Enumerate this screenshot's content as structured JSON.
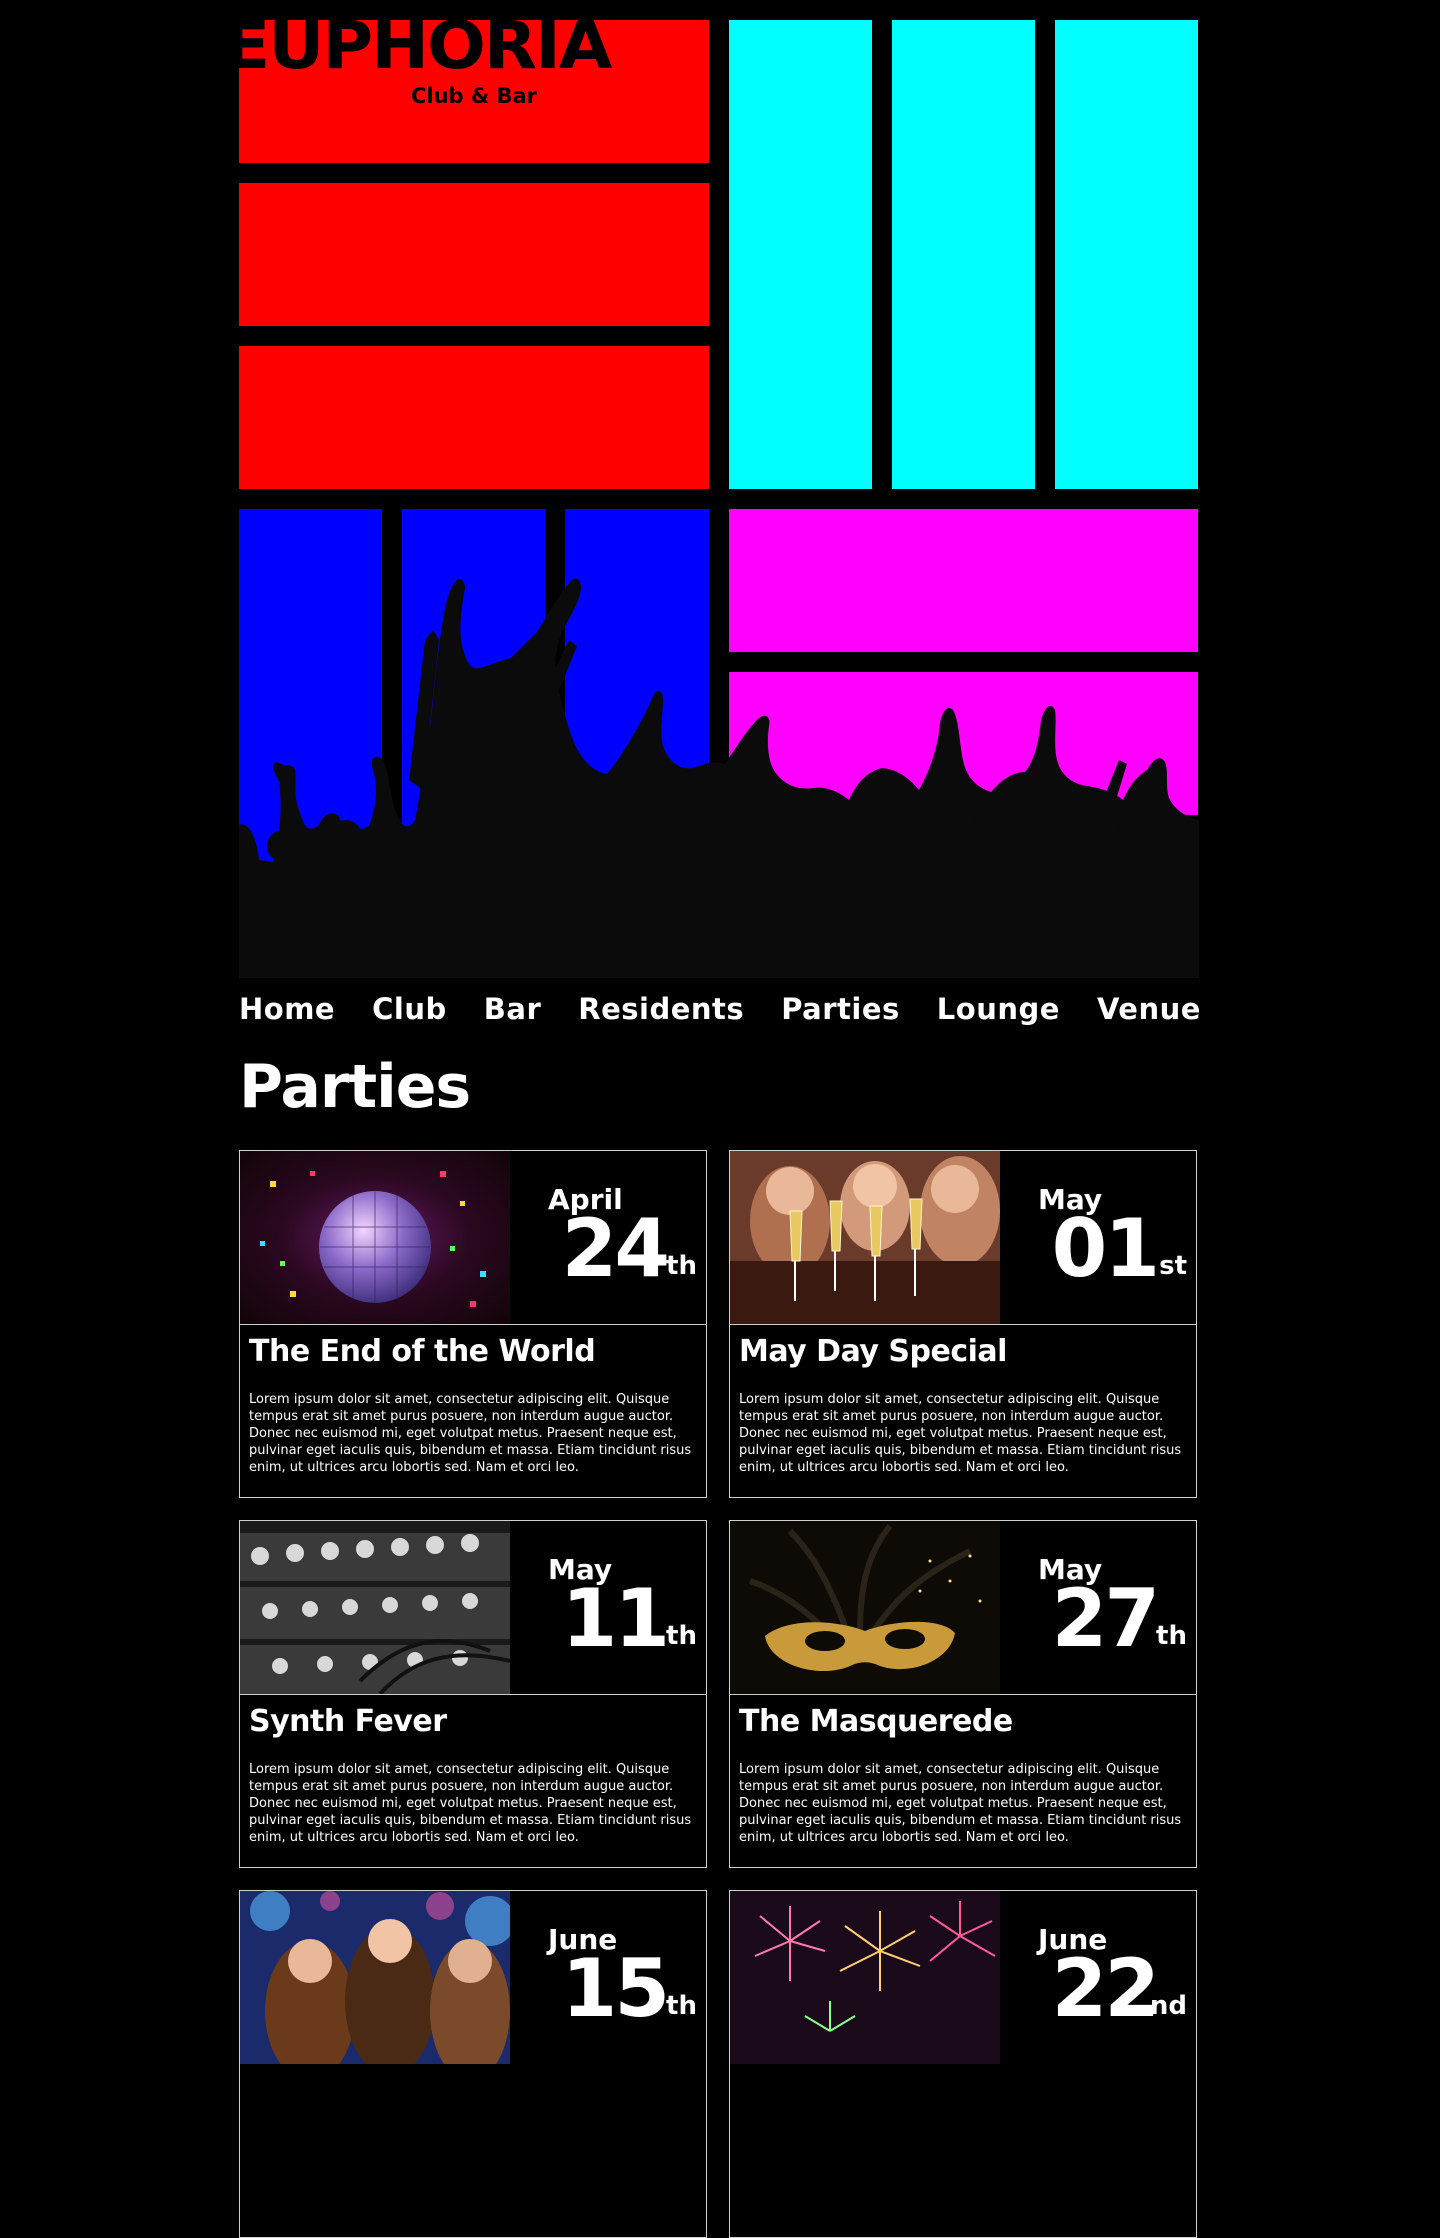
{
  "site": {
    "logo_text": "EUPHORIA",
    "tagline": "Club & Bar"
  },
  "colors": {
    "red": "#ff0000",
    "cyan": "#00ffff",
    "blue": "#0000ff",
    "magenta": "#ff00ff",
    "background": "#000000"
  },
  "nav": {
    "items": [
      {
        "label": "Home"
      },
      {
        "label": "Club"
      },
      {
        "label": "Bar"
      },
      {
        "label": "Residents"
      },
      {
        "label": "Parties"
      },
      {
        "label": "Lounge"
      },
      {
        "label": "Venue"
      }
    ]
  },
  "page": {
    "title": "Parties"
  },
  "parties": [
    {
      "month": "April",
      "day": "24",
      "suffix": "th",
      "title": "The End of the World",
      "image": "disco-ball-image",
      "text": "Lorem ipsum dolor sit amet, consectetur adipiscing elit. Quisque tempus erat sit amet purus posuere, non interdum augue auctor. Donec nec euismod mi, eget volutpat metus. Praesent neque est, pulvinar eget iaculis quis, bibendum et massa. Etiam tincidunt risus enim, ut ultrices arcu lobortis sed. Nam et orci leo."
    },
    {
      "month": "May",
      "day": "01",
      "suffix": "st",
      "title": "May Day Special",
      "image": "champagne-toast-image",
      "text": "Lorem ipsum dolor sit amet, consectetur adipiscing elit. Quisque tempus erat sit amet purus posuere, non interdum augue auctor. Donec nec euismod mi, eget volutpat metus. Praesent neque est, pulvinar eget iaculis quis, bibendum et massa. Etiam tincidunt risus enim, ut ultrices arcu lobortis sed. Nam et orci leo."
    },
    {
      "month": "May",
      "day": "11",
      "suffix": "th",
      "title": "Synth Fever",
      "image": "synthesizer-image",
      "text": "Lorem ipsum dolor sit amet, consectetur adipiscing elit. Quisque tempus erat sit amet purus posuere, non interdum augue auctor. Donec nec euismod mi, eget volutpat metus. Praesent neque est, pulvinar eget iaculis quis, bibendum et massa. Etiam tincidunt risus enim, ut ultrices arcu lobortis sed. Nam et orci leo."
    },
    {
      "month": "May",
      "day": "27",
      "suffix": "th",
      "title": "The Masquerede",
      "image": "masquerade-mask-image",
      "text": "Lorem ipsum dolor sit amet, consectetur adipiscing elit. Quisque tempus erat sit amet purus posuere, non interdum augue auctor. Donec nec euismod mi, eget volutpat metus. Praesent neque est, pulvinar eget iaculis quis, bibendum et massa. Etiam tincidunt risus enim, ut ultrices arcu lobortis sed. Nam et orci leo."
    },
    {
      "month": "June",
      "day": "15",
      "suffix": "th",
      "title": "",
      "image": "dancing-crowd-image",
      "text": ""
    },
    {
      "month": "June",
      "day": "22",
      "suffix": "nd",
      "title": "",
      "image": "fireworks-image",
      "text": ""
    }
  ]
}
